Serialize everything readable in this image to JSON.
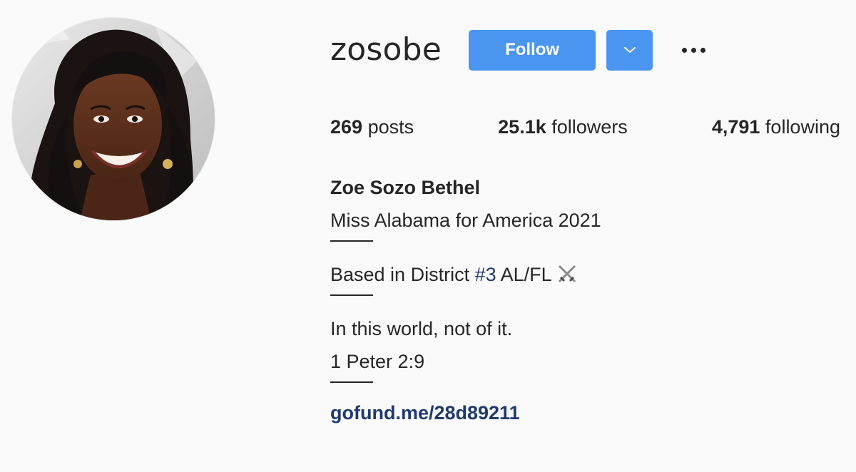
{
  "profile": {
    "username": "zosobe",
    "follow_label": "Follow",
    "stats": {
      "posts_count": "269",
      "posts_label": "posts",
      "followers_count": "25.1k",
      "followers_label": "followers",
      "following_count": "4,791",
      "following_label": "following"
    },
    "full_name": "Zoe Sozo Bethel",
    "bio": {
      "line1": "Miss Alabama for America 2021",
      "line2_prefix": "Based in District ",
      "line2_hashtag": "#3",
      "line2_suffix": " AL/FL",
      "line3": "In this world, not of it.",
      "line4": "1 Peter 2:9"
    },
    "link": "gofund.me/28d89211"
  },
  "colors": {
    "primary_button": "#4a95ef",
    "link": "#1f3a6e",
    "background": "#fafafa",
    "text": "#262626"
  },
  "icons": {
    "dropdown": "chevron-down-icon",
    "more": "more-options-icon",
    "emoji": "crossed-swords-icon"
  }
}
